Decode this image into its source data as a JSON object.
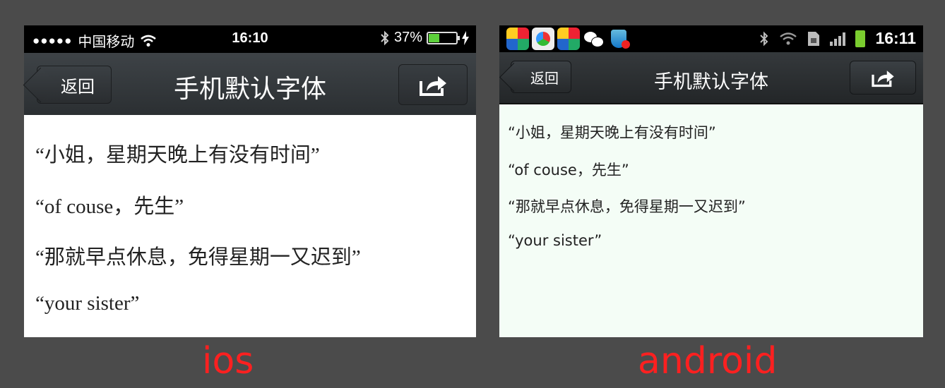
{
  "ios": {
    "status": {
      "signal_dots": "●●●●●",
      "carrier": "中国移动",
      "time": "16:10",
      "battery_percent": "37%",
      "battery_level": 0.37
    },
    "nav": {
      "back_label": "返回",
      "title": "手机默认字体",
      "share_icon": "share-icon"
    },
    "lines": [
      "“小姐，星期天晚上有没有时间”",
      "“of couse，先生”",
      "“那就早点休息，免得星期一又迟到”",
      "“your sister”"
    ]
  },
  "android": {
    "status": {
      "time": "16:11"
    },
    "nav": {
      "back_label": "返回",
      "title": "手机默认字体",
      "share_icon": "share-icon"
    },
    "lines": [
      "“小姐，星期天晚上有没有时间”",
      "“of couse，先生”",
      "“那就早点休息，免得星期一又迟到”",
      "“your sister”"
    ]
  },
  "captions": {
    "ios": "ios",
    "android": "android"
  },
  "colors": {
    "caption": "#ff2020",
    "background": "#4b4b4b",
    "android_content_bg": "#f4fdf6"
  }
}
